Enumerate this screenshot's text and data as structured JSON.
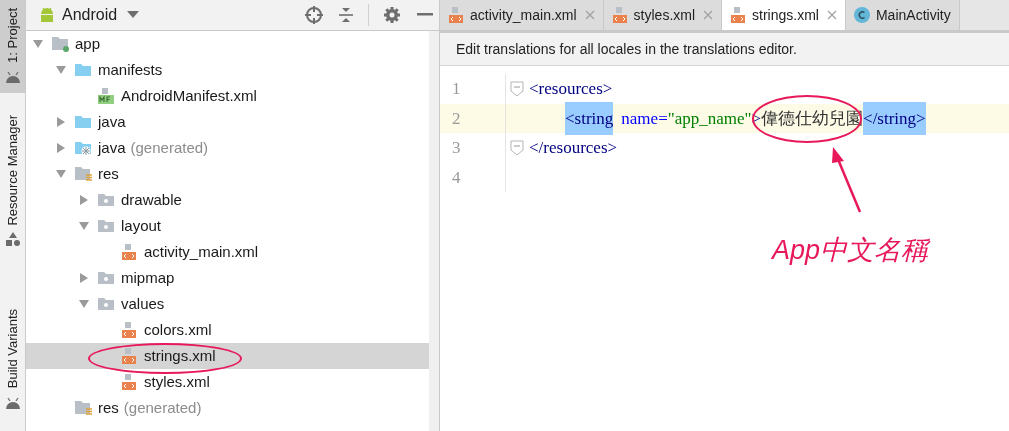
{
  "tool_strip": [
    {
      "label": "1: Project",
      "selected": true,
      "kind": "android"
    },
    {
      "label": "Resource Manager",
      "selected": false,
      "kind": "shapes"
    },
    {
      "label": "Build Variants",
      "selected": false,
      "kind": "android"
    }
  ],
  "project": {
    "view": "Android",
    "tree": [
      {
        "label": "app",
        "kind": "module",
        "expanded": true,
        "selected": false,
        "children": [
          {
            "label": "manifests",
            "kind": "folder",
            "expanded": true,
            "selected": false,
            "children": [
              {
                "label": "AndroidManifest.xml",
                "kind": "manifest-file",
                "selected": false
              }
            ]
          },
          {
            "label": "java",
            "kind": "folder",
            "expanded": false,
            "selected": false
          },
          {
            "label": "java",
            "suffix": "(generated)",
            "kind": "generated-folder",
            "expanded": false,
            "selected": false
          },
          {
            "label": "res",
            "kind": "res-folder",
            "expanded": true,
            "selected": false,
            "children": [
              {
                "label": "drawable",
                "kind": "package",
                "expanded": false,
                "selected": false
              },
              {
                "label": "layout",
                "kind": "package",
                "expanded": true,
                "selected": false,
                "children": [
                  {
                    "label": "activity_main.xml",
                    "kind": "xml-file",
                    "selected": false
                  }
                ]
              },
              {
                "label": "mipmap",
                "kind": "package",
                "expanded": false,
                "selected": false
              },
              {
                "label": "values",
                "kind": "package",
                "expanded": true,
                "selected": false,
                "children": [
                  {
                    "label": "colors.xml",
                    "kind": "xml-file",
                    "selected": false
                  },
                  {
                    "label": "strings.xml",
                    "kind": "xml-file",
                    "selected": true
                  },
                  {
                    "label": "styles.xml",
                    "kind": "xml-file",
                    "selected": false
                  }
                ]
              }
            ]
          },
          {
            "label": "res",
            "suffix": "(generated)",
            "kind": "res-folder",
            "selected": false
          }
        ]
      }
    ]
  },
  "editor": {
    "tabs": [
      {
        "label": "activity_main.xml",
        "kind": "xml",
        "selected": false,
        "closable": true
      },
      {
        "label": "styles.xml",
        "kind": "xml",
        "selected": false,
        "closable": true
      },
      {
        "label": "strings.xml",
        "kind": "xml",
        "selected": true,
        "closable": true
      },
      {
        "label": "MainActivity",
        "kind": "class",
        "selected": false,
        "closable": false
      }
    ],
    "banner": "Edit translations for all locales in the translations editor.",
    "lines": [
      {
        "number": "1",
        "current": false,
        "indented": false,
        "fold": true,
        "tokens": [
          {
            "kind": "tag",
            "text": "<resources>",
            "highlighted": false
          }
        ]
      },
      {
        "number": "2",
        "current": true,
        "indented": true,
        "fold": false,
        "tokens": [
          {
            "kind": "tag",
            "text": "<string",
            "highlighted": true
          },
          {
            "kind": "attr",
            "text": "name=",
            "highlighted": false
          },
          {
            "kind": "value",
            "text": "\"app_name\"",
            "highlighted": false
          },
          {
            "kind": "tag",
            "text": ">",
            "highlighted": false
          },
          {
            "kind": "text",
            "text": "偉德仕幼兒園",
            "highlighted": false
          },
          {
            "kind": "tag",
            "text": "</string>",
            "highlighted": true
          }
        ]
      },
      {
        "number": "3",
        "current": false,
        "indented": false,
        "fold": true,
        "tokens": [
          {
            "kind": "tag",
            "text": "</resources>",
            "highlighted": false
          }
        ]
      },
      {
        "number": "4",
        "current": false,
        "indented": false,
        "fold": false
      }
    ]
  },
  "annotation": {
    "note": "App中文名稱"
  }
}
